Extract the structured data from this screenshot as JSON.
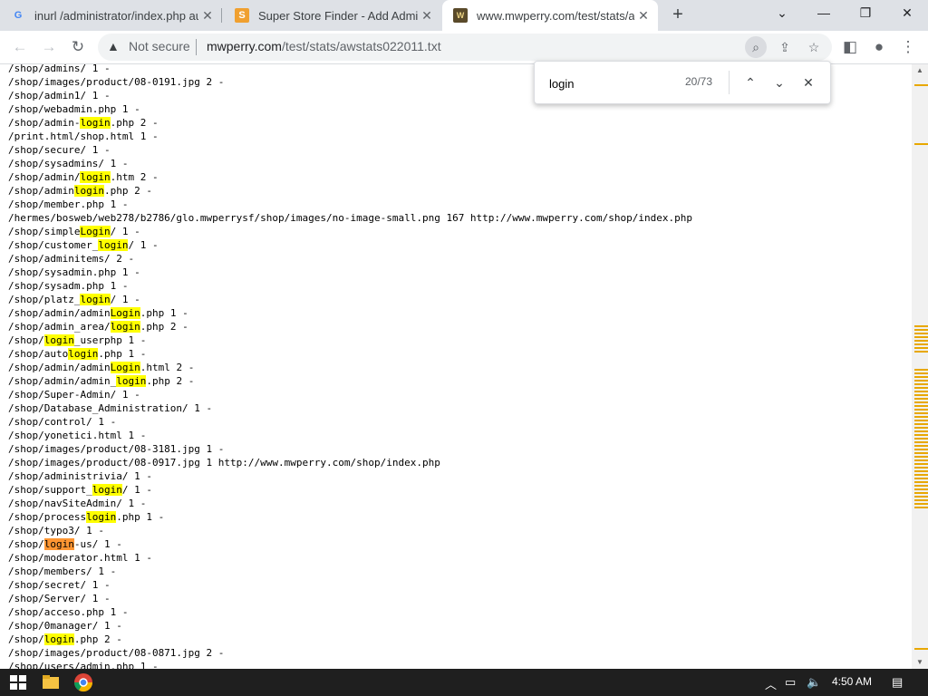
{
  "tabs": [
    {
      "title": "inurl /administrator/index.php au",
      "favicon": "google-icon"
    },
    {
      "title": "Super Store Finder - Add Admin",
      "favicon": "store-icon"
    },
    {
      "title": "www.mwperry.com/test/stats/aw",
      "favicon": "awstats-icon"
    }
  ],
  "toolbar": {
    "security_label": "Not secure",
    "url_host": "mwperry.com",
    "url_path": "/test/stats/awstats022011.txt"
  },
  "find": {
    "query": "login",
    "count": "20/73"
  },
  "lines": [
    {
      "pre": "/shop/admins/ 1 -",
      "hit": "",
      "post": ""
    },
    {
      "pre": "/shop/images/product/08-0191.jpg 2 -",
      "hit": "",
      "post": ""
    },
    {
      "pre": "/shop/admin1/ 1 -",
      "hit": "",
      "post": ""
    },
    {
      "pre": "/shop/webadmin.php 1 -",
      "hit": "",
      "post": ""
    },
    {
      "pre": "/shop/admin-",
      "hit": "login",
      "post": ".php 2 -"
    },
    {
      "pre": "/print.html/shop.html 1 -",
      "hit": "",
      "post": ""
    },
    {
      "pre": "/shop/secure/ 1 -",
      "hit": "",
      "post": ""
    },
    {
      "pre": "/shop/sysadmins/ 1 -",
      "hit": "",
      "post": ""
    },
    {
      "pre": "/shop/admin/",
      "hit": "login",
      "post": ".htm 2 -"
    },
    {
      "pre": "/shop/admin",
      "hit": "login",
      "post": ".php 2 -"
    },
    {
      "pre": "/shop/member.php 1 -",
      "hit": "",
      "post": ""
    },
    {
      "pre": "/hermes/bosweb/web278/b2786/glo.mwperrysf/shop/images/no-image-small.png 167 http://www.mwperry.com/shop/index.php",
      "hit": "",
      "post": ""
    },
    {
      "pre": "/shop/simple",
      "hit": "Login",
      "post": "/ 1 -"
    },
    {
      "pre": "/shop/customer_",
      "hit": "login",
      "post": "/ 1 -"
    },
    {
      "pre": "/shop/adminitems/ 2 -",
      "hit": "",
      "post": ""
    },
    {
      "pre": "/shop/sysadmin.php 1 -",
      "hit": "",
      "post": ""
    },
    {
      "pre": "/shop/sysadm.php 1 -",
      "hit": "",
      "post": ""
    },
    {
      "pre": "/shop/platz_",
      "hit": "login",
      "post": "/ 1 -"
    },
    {
      "pre": "/shop/admin/admin",
      "hit": "Login",
      "post": ".php 1 -"
    },
    {
      "pre": "/shop/admin_area/",
      "hit": "login",
      "post": ".php 2 -"
    },
    {
      "pre": "/shop/",
      "hit": "login",
      "post": "_userphp 1 -"
    },
    {
      "pre": "/shop/auto",
      "hit": "login",
      "post": ".php 1 -"
    },
    {
      "pre": "/shop/admin/admin",
      "hit": "Login",
      "post": ".html 2 -"
    },
    {
      "pre": "/shop/admin/admin_",
      "hit": "login",
      "post": ".php 2 -"
    },
    {
      "pre": "/shop/Super-Admin/ 1 -",
      "hit": "",
      "post": ""
    },
    {
      "pre": "/shop/Database_Administration/ 1 -",
      "hit": "",
      "post": ""
    },
    {
      "pre": "/shop/control/ 1 -",
      "hit": "",
      "post": ""
    },
    {
      "pre": "/shop/yonetici.html 1 -",
      "hit": "",
      "post": ""
    },
    {
      "pre": "/shop/images/product/08-3181.jpg 1 -",
      "hit": "",
      "post": ""
    },
    {
      "pre": "/shop/images/product/08-0917.jpg 1 http://www.mwperry.com/shop/index.php",
      "hit": "",
      "post": ""
    },
    {
      "pre": "/shop/administrivia/ 1 -",
      "hit": "",
      "post": ""
    },
    {
      "pre": "/shop/support_",
      "hit": "login",
      "post": "/ 1 -"
    },
    {
      "pre": "/shop/navSiteAdmin/ 1 -",
      "hit": "",
      "post": ""
    },
    {
      "pre": "/shop/process",
      "hit": "login",
      "post": ".php 1 -"
    },
    {
      "pre": "/shop/typo3/ 1 -",
      "hit": "",
      "post": ""
    },
    {
      "pre": "/shop/",
      "hit": "login",
      "post": "-us/ 1 -",
      "current": true
    },
    {
      "pre": "/shop/moderator.html 1 -",
      "hit": "",
      "post": ""
    },
    {
      "pre": "/shop/members/ 1 -",
      "hit": "",
      "post": ""
    },
    {
      "pre": "/shop/secret/ 1 -",
      "hit": "",
      "post": ""
    },
    {
      "pre": "/shop/Server/ 1 -",
      "hit": "",
      "post": ""
    },
    {
      "pre": "/shop/acceso.php 1 -",
      "hit": "",
      "post": ""
    },
    {
      "pre": "/shop/0manager/ 1 -",
      "hit": "",
      "post": ""
    },
    {
      "pre": "/shop/",
      "hit": "login",
      "post": ".php 2 -"
    },
    {
      "pre": "/shop/images/product/08-0871.jpg 2 -",
      "hit": "",
      "post": ""
    },
    {
      "pre": "/shop/users/admin.php 1 -",
      "hit": "",
      "post": ""
    }
  ],
  "taskbar": {
    "clock": "4:50 AM"
  },
  "colors": {
    "match_highlight": "#ffff00",
    "current_match_highlight": "#ff9632",
    "scrollbar_marker": "#e8a800"
  }
}
